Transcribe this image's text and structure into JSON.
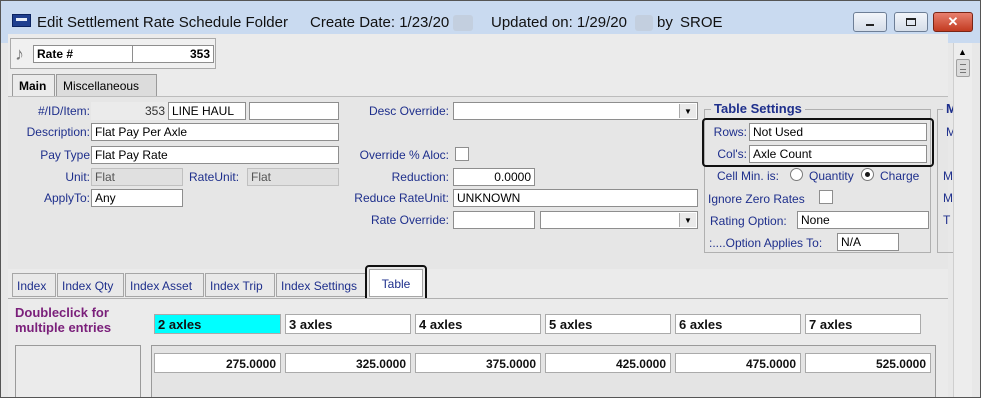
{
  "titlebar": {
    "title": "Edit Settlement Rate Schedule Folder",
    "create_date": "Create Date: 1/23/20",
    "updated_on": "Updated on: 1/29/20",
    "by": "by",
    "user": "SROE",
    "min_icon": "minimize-icon",
    "max_icon": "maximize-icon",
    "close_label": "✕"
  },
  "header": {
    "music_icon": "music-note-icon",
    "rate_label": "Rate #",
    "rate_value": "353"
  },
  "tabs": [
    {
      "label": "Main",
      "active": true
    },
    {
      "label": "Miscellaneous",
      "active": false
    }
  ],
  "main": {
    "id_item_label": "#/ID/Item:",
    "id_value": "353",
    "id_item_value": "LINE HAUL",
    "id_item_extra": "",
    "description_label": "Description:",
    "description_value": "Flat Pay Per Axle",
    "pay_type_label": "Pay Type",
    "pay_type_value": "Flat Pay Rate",
    "unit_label": "Unit:",
    "unit_value": "Flat",
    "rate_unit_label": "RateUnit:",
    "rate_unit_value": "Flat",
    "apply_to_label": "ApplyTo:",
    "apply_to_value": "Any",
    "desc_override_label": "Desc Override:",
    "desc_override_value": "",
    "override_aloc_label": "Override % Aloc:",
    "reduction_label": "Reduction:",
    "reduction_value": "0.0000",
    "reduce_rate_unit_label": "Reduce RateUnit:",
    "reduce_rate_unit_value": "UNKNOWN",
    "rate_override_label": "Rate Override:",
    "rate_override_value": "",
    "rate_override_select": ""
  },
  "table_settings": {
    "title": "Table Settings",
    "rows_label": "Rows:",
    "rows_value": "Not Used",
    "cols_label": "Col's:",
    "cols_value": "Axle Count",
    "cell_min_label": "Cell Min. is:",
    "quantity_label": "Quantity",
    "charge_label": "Charge",
    "selected": "Charge",
    "ignore_zero_label": "Ignore Zero Rates",
    "rating_option_label": "Rating Option:",
    "rating_option_value": "None",
    "option_applies_label": ":....Option Applies To:",
    "option_applies_value": "N/A"
  },
  "right_cut": {
    "group_letter": "M",
    "letters": [
      "M",
      "M",
      "M",
      "T"
    ]
  },
  "subtabs": [
    {
      "label": "Index"
    },
    {
      "label": "Index Qty"
    },
    {
      "label": "Index Asset"
    },
    {
      "label": "Index Trip"
    },
    {
      "label": "Index Settings"
    },
    {
      "label": "Table"
    }
  ],
  "table": {
    "hint": "Doubleclick for multiple entries",
    "columns": [
      "2 axles",
      "3 axles",
      "4 axles",
      "5 axles",
      "6 axles",
      "7 axles"
    ],
    "values": [
      "275.0000",
      "325.0000",
      "375.0000",
      "425.0000",
      "475.0000",
      "525.0000"
    ],
    "selected_color": "#00ffff"
  },
  "colors": {
    "label_blue": "#1e2f8c",
    "hint_purple": "#7a1f7a",
    "titlebar": "#c9daf0"
  }
}
